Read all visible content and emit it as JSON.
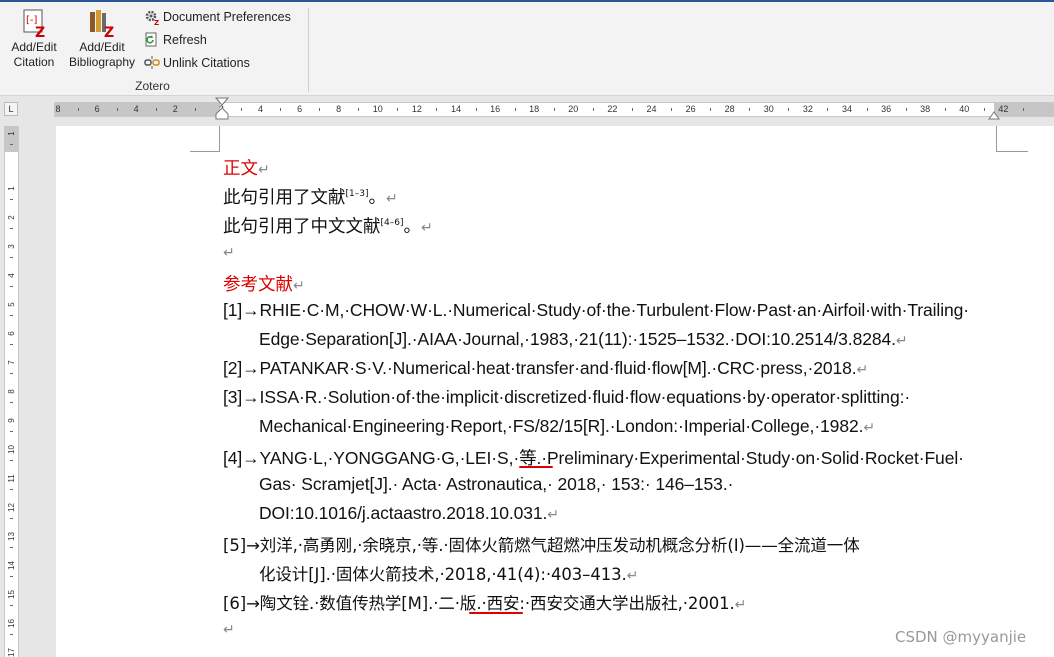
{
  "ribbon": {
    "add_edit_citation": "Add/Edit\nCitation",
    "add_edit_citation_line1": "Add/Edit",
    "add_edit_citation_line2": "Citation",
    "add_edit_bibliography_line1": "Add/Edit",
    "add_edit_bibliography_line2": "Bibliography",
    "document_preferences": "Document Preferences",
    "refresh": "Refresh",
    "unlink_citations": "Unlink Citations",
    "group_label": "Zotero"
  },
  "ruler": {
    "tab_selector": "L",
    "h_numbers": [
      "8",
      "6",
      "4",
      "2",
      "2",
      "4",
      "6",
      "8",
      "10",
      "12",
      "14",
      "16",
      "18",
      "20",
      "22",
      "24",
      "26",
      "28",
      "30",
      "32",
      "34",
      "36",
      "38",
      "40",
      "42"
    ],
    "v_numbers": [
      "1",
      "1",
      "2",
      "3",
      "4",
      "5",
      "6",
      "7",
      "8",
      "9",
      "10",
      "11",
      "12",
      "13",
      "14",
      "15",
      "16",
      "17"
    ]
  },
  "document": {
    "heading_body": "正文",
    "line1_text": "此句引用了文献",
    "line1_cite": "[1–3]",
    "line1_end": "。",
    "line2_text": "此句引用了中文文献",
    "line2_cite": "[4–6]",
    "line2_end": "。",
    "heading_refs": "参考文献",
    "refs": {
      "r1_a": "[1]→RHIE·C·M,·CHOW·W·L.·Numerical·Study·of·the·Turbulent·Flow·Past·an·Airfoil·with·Trailing·",
      "r1_b": "Edge·Separation[J].·AIAA·Journal,·1983,·21(11):·1525–1532.·DOI:10.2514/3.8284.",
      "r2_a": "[2]→PATANKAR·S·V.·Numerical·heat·transfer·and·fluid·flow[M].·CRC·press,·2018.",
      "r3_a": "[3]→ISSA·R.·Solution·of·the·implicit·discretized·fluid·flow·equations·by·operator·splitting:·",
      "r3_b": "Mechanical·Engineering·Report,·FS/82/15[R].·London:·Imperial·College,·1982.",
      "r4_a1": "[4]→YANG·L,·YONGGANG·G,·LEI·S,",
      "r4_a2": "·等.",
      "r4_a3": "·Preliminary·Experimental·Study·on·Solid·Rocket·Fuel·",
      "r4_b": "Gas·        Scramjet[J].·        Acta·        Astronautica,·        2018,·        153:·        146–153.·",
      "r4_c": "DOI:10.1016/j.actaastro.2018.10.031.",
      "r5_a": "[5]→刘洋,·高勇刚,·余晓京,·等.·固体火箭燃气超燃冲压发动机概念分析(Ⅰ)——全流道一体",
      "r5_b": "化设计[J].·固体火箭技术,·2018,·41(4):·403–413.",
      "r6_a1": "[6]→陶文铨.·数值传热学[M].·",
      "r6_a2": "二·版",
      "r6_a3": ".·西安:·西安交通大学出版社,·2001."
    },
    "pilcrow": "↵"
  },
  "watermark": "CSDN @myyanjie",
  "colors": {
    "accent": "#2b579a",
    "heading_red": "#e00000"
  }
}
